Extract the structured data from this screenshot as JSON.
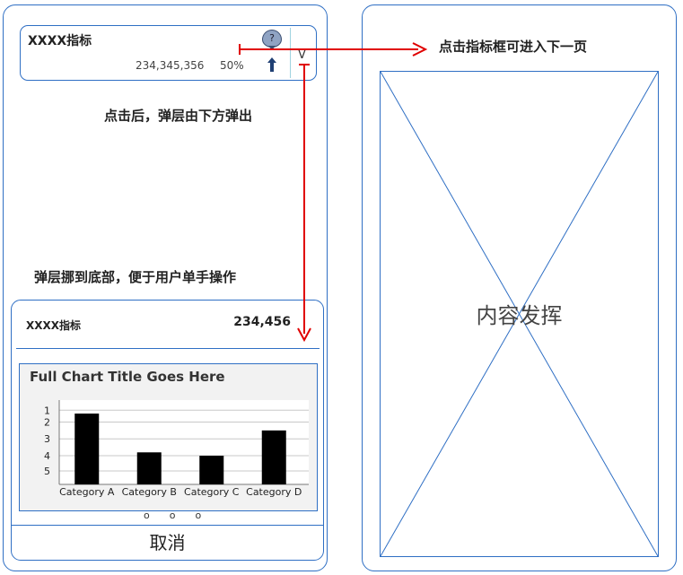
{
  "metric_card": {
    "title": "XXXX指标",
    "value": "234,345,356",
    "percent": "50%",
    "help_glyph": "?",
    "expand_glyph": "V"
  },
  "annotations": {
    "popup_from_bottom": "点击后，弹层由下方弹出",
    "move_to_bottom": "弹层挪到底部，便于用户单手操作",
    "click_next_page": "点击指标框可进入下一页"
  },
  "sheet": {
    "title": "XXXX指标",
    "value": "234,456",
    "pager_dots": "ooo",
    "cancel_label": "取消"
  },
  "chart_data": {
    "type": "bar",
    "title": "Full Chart Title Goes Here",
    "categories": [
      "Category A",
      "Category B",
      "Category C",
      "Category D"
    ],
    "values": [
      1.6,
      3.9,
      4.1,
      2.6
    ],
    "y_ticks": [
      "1",
      "2",
      "3",
      "4",
      "5"
    ],
    "y_tick_values": [
      1.4,
      2.1,
      3.1,
      4.1,
      5.0
    ],
    "ylim": [
      0.8,
      5.8
    ],
    "y_axis_inverted": true,
    "grid": true,
    "bar_color": "#000000",
    "xlabel": "",
    "ylabel": ""
  },
  "content_page": {
    "label": "内容发挥"
  },
  "colors": {
    "frame": "#2f6fc4",
    "flow_arrow": "#e00000",
    "chart_bg": "#f2f2f2"
  },
  "icons": {
    "help": "help-bubble-icon",
    "trend": "arrow-up-icon",
    "expand": "chevron-down-icon"
  }
}
